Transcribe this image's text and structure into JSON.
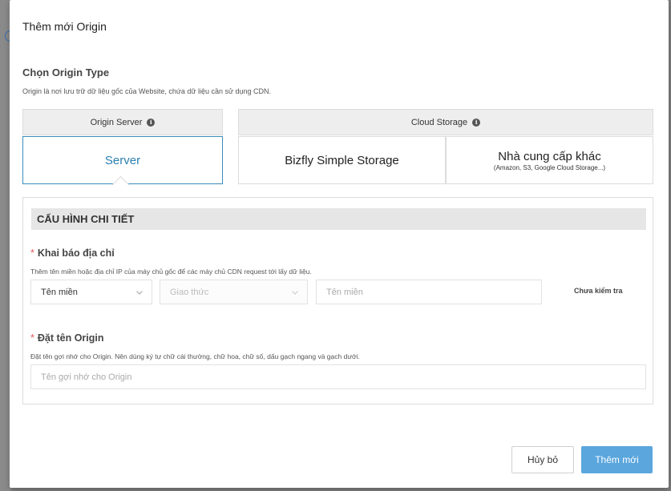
{
  "modal": {
    "title": "Thêm mới Origin"
  },
  "origin_type": {
    "title": "Chọn Origin Type",
    "description": "Origin là nơi lưu trữ dữ liệu gốc của Website, chứa dữ liệu cần sử dụng CDN.",
    "tabs": {
      "origin_server": "Origin Server",
      "cloud_storage": "Cloud Storage"
    },
    "options": {
      "server": "Server",
      "bizfly": "Bizfly Simple Storage",
      "other_main": "Nhà cung cấp khác",
      "other_sub": "(Amazon, S3, Google Cloud Storage...)"
    },
    "selected": "Server"
  },
  "detail": {
    "header": "CẤU HÌNH CHI TIẾT",
    "address": {
      "label": "Khai báo địa chỉ",
      "hint": "Thêm tên miền hoặc địa chỉ IP của máy chủ gốc để các máy chủ CDN request tới lấy dữ liệu.",
      "type_select_value": "Tên miền",
      "protocol_placeholder": "Giao thức",
      "domain_placeholder": "Tên miền",
      "status": "Chưa kiểm tra"
    },
    "origin_name": {
      "label": "Đặt tên Origin",
      "hint": "Đặt tên gợi nhớ cho Origin. Nên dùng ký tự chữ cái thường, chữ hoa, chữ số, dấu gạch ngang và gạch dưới.",
      "placeholder": "Tên gợi nhớ cho Origin"
    }
  },
  "footer": {
    "cancel_label": "Hủy bỏ",
    "submit_label": "Thêm mới"
  },
  "colors": {
    "accent": "#5aa6dd",
    "selected_border": "#3b8dbb",
    "required": "#e05a5a"
  },
  "icons": {
    "info": "info-icon",
    "chevron": "chevron-down-icon"
  }
}
